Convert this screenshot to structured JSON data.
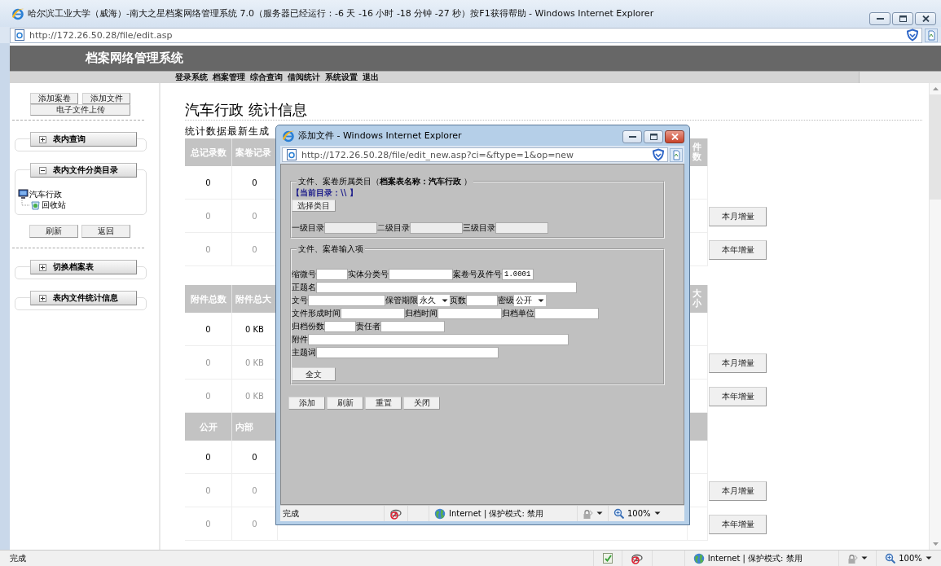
{
  "window": {
    "title": "哈尔滨工业大学（威海）-南大之星档案网络管理系统 7.0（服务器已经运行：-6 天 -16 小时 -18 分钟 -27 秒）按F1获得帮助 - Windows Internet Explorer",
    "address": "http://172.26.50.28/file/edit.asp"
  },
  "site": {
    "title": "档案网络管理系统",
    "menu": [
      "登录系统",
      "档案管理",
      "综合查询",
      "借阅统计",
      "系统设置",
      "退出"
    ]
  },
  "sidebar": {
    "top_buttons": [
      "添加案卷",
      "添加文件",
      "电子文件上传"
    ],
    "panels": [
      {
        "label": "表内查询",
        "expanded": false
      },
      {
        "label": "表内文件分类目录",
        "expanded": true,
        "tree": [
          {
            "label": "汽车行政",
            "kind": "computer",
            "children": [
              {
                "label": "回收站",
                "kind": "recycle"
              }
            ]
          }
        ],
        "buttons": [
          "刷新",
          "返回"
        ]
      },
      {
        "label": "切换档案表",
        "expanded": false
      },
      {
        "label": "表内文件统计信息",
        "expanded": false
      }
    ]
  },
  "main": {
    "heading": "汽车行政 统计信息",
    "subtitle": "统计数据最新生成",
    "tables": [
      {
        "columns": [
          "总记录数",
          "案卷记录"
        ],
        "last_column": "件数",
        "rows": [
          {
            "cells": [
              "0",
              "0"
            ],
            "muted": false
          },
          {
            "cells": [
              "0",
              "0"
            ],
            "muted": true,
            "button": "本月增量"
          },
          {
            "cells": [
              "0",
              "0"
            ],
            "muted": true,
            "button": "本年增量"
          }
        ]
      },
      {
        "columns": [
          "附件总数",
          "附件总大"
        ],
        "last_column": "大小",
        "rows": [
          {
            "cells": [
              "0",
              "0 KB"
            ],
            "muted": false
          },
          {
            "cells": [
              "0",
              "0 KB"
            ],
            "muted": true,
            "button": "本月增量"
          },
          {
            "cells": [
              "0",
              "0 KB"
            ],
            "muted": true,
            "button": "本年增量"
          }
        ]
      },
      {
        "columns": [
          "公开",
          "内部"
        ],
        "rows": [
          {
            "cells": [
              "0",
              "0"
            ],
            "muted": false
          },
          {
            "cells": [
              "0",
              "0"
            ],
            "muted": true,
            "button": "本月增量"
          },
          {
            "cells": [
              "0",
              "0"
            ],
            "muted": true,
            "button": "本年增量"
          }
        ]
      }
    ]
  },
  "dialog": {
    "title": "添加文件 - Windows Internet Explorer",
    "address": "http://172.26.50.28/file/edit_new.asp?ci=&ftype=1&op=new",
    "category": {
      "legend": "文件、案卷所属类目（**档案表名称：汽车行政** ）",
      "current_dir": "【当前目录：\\\\ 】",
      "select_button": "选择类目",
      "levels": [
        "一级目录",
        "二级目录",
        "三级目录"
      ]
    },
    "inputs": {
      "legend": "文件、案卷输入项",
      "rows": [
        [
          {
            "label": "缩微号",
            "kind": "short"
          },
          {
            "label": "实体分类号",
            "kind": "medium"
          },
          {
            "label": "案卷号及件号",
            "kind": "short",
            "value": "1.0001"
          }
        ],
        [
          {
            "label": "正题名",
            "kind": "full"
          }
        ],
        [
          {
            "label": "文号",
            "kind": "long"
          },
          {
            "label": "保管期限",
            "kind": "select",
            "value": "永久"
          },
          {
            "label": "页数",
            "kind": "short"
          },
          {
            "label": "密级",
            "kind": "select",
            "value": "公开"
          }
        ],
        [
          {
            "label": "文件形成时间",
            "kind": "medium"
          },
          {
            "label": "归档时间",
            "kind": "medium"
          },
          {
            "label": "归档单位",
            "kind": "medium"
          }
        ],
        [
          {
            "label": "归档份数",
            "kind": "short"
          },
          {
            "label": "责任者",
            "kind": "medium"
          }
        ],
        [
          {
            "label": "附件",
            "kind": "full"
          }
        ],
        [
          {
            "label": "主题词",
            "kind": "wide"
          }
        ]
      ],
      "fulltext_button": "全文"
    },
    "buttons": [
      "添加",
      "刷新",
      "重置",
      "关闭"
    ],
    "status": {
      "text": "完成",
      "zone": "Internet | 保护模式: 禁用",
      "zoom": "100%"
    }
  },
  "status_bar": {
    "text": "完成",
    "zone": "Internet | 保护模式: 禁用",
    "zoom": "100%"
  }
}
